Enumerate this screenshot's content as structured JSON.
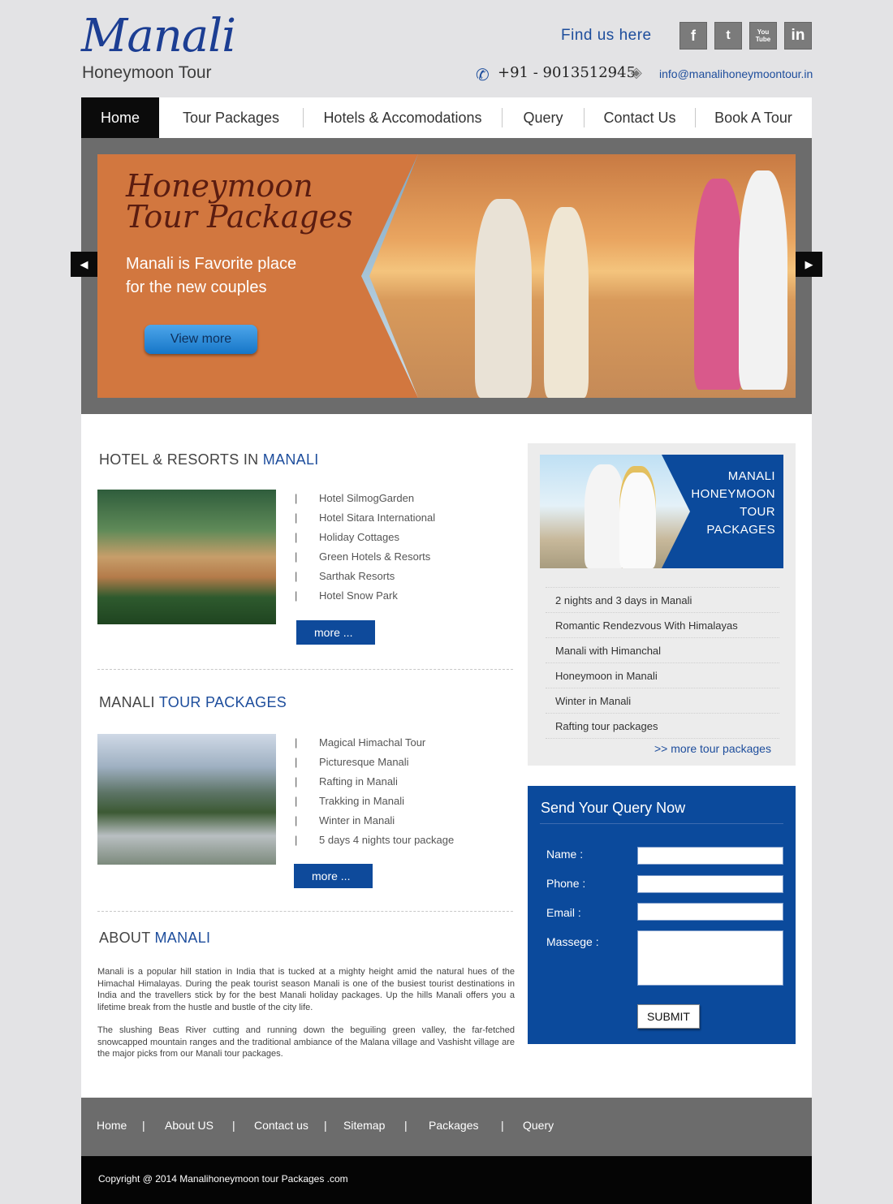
{
  "header": {
    "logo_script": "Manali",
    "logo_subtitle": "Honeymoon Tour",
    "find_us": "Find us here",
    "social": [
      {
        "icon": "facebook-icon",
        "glyph": "f"
      },
      {
        "icon": "twitter-icon",
        "glyph": "t"
      },
      {
        "icon": "youtube-icon",
        "glyph": "You Tube"
      },
      {
        "icon": "linkedin-icon",
        "glyph": "in"
      }
    ],
    "phone": "+91 - 9013512945",
    "email": "info@manalihoneymoontour.in"
  },
  "nav": {
    "items": [
      "Home",
      "Tour Packages",
      "Hotels & Accomodations",
      "Query",
      "Contact Us",
      "Book A Tour"
    ],
    "active": "Home"
  },
  "banner": {
    "title": "Honeymoon Tour Packages",
    "subtitle_line1": "Manali is Favorite place",
    "subtitle_line2": "for the new couples",
    "button": "View more",
    "prev": "◀",
    "next": "▶"
  },
  "hotels": {
    "title_plain": "HOTEL & RESORTS IN",
    "title_highlight": "MANALI",
    "items": [
      "Hotel SilmogGarden",
      "Hotel Sitara International",
      "Holiday Cottages",
      "Green Hotels & Resorts",
      "Sarthak Resorts",
      "Hotel Snow Park"
    ],
    "more": "more ..."
  },
  "tours": {
    "title_plain": "MANALI",
    "title_highlight": "TOUR PACKAGES",
    "items": [
      "Magical Himachal Tour",
      "Picturesque Manali",
      "Rafting in Manali",
      "Trakking in Manali",
      "Winter in Manali",
      "5 days 4 nights tour package"
    ],
    "more": "more ..."
  },
  "about": {
    "title_plain": "ABOUT",
    "title_highlight": "MANALI",
    "para1": "Manali is a popular hill station in India that is tucked at a mighty height amid the natural hues of the Himachal Himalayas. During the peak tourist season Manali is one of the busiest tourist destinations in India and the travellers stick by for the best Manali holiday packages. Up the hills Manali offers you a lifetime break from the hustle and bustle of the city life.",
    "para2": "The slushing Beas River cutting and running down the beguiling green valley, the far-fetched snowcapped mountain ranges and the traditional ambiance of the Malana village and Vashisht village are the major picks from our Manali tour packages."
  },
  "packages": {
    "heading_line1": "MANALI",
    "heading_line2": "HONEYMOON",
    "heading_line3": "TOUR",
    "heading_line4": "PACKAGES",
    "items": [
      "2 nights and 3 days in Manali",
      "Romantic Rendezvous With Himalayas",
      "Manali with Himanchal",
      "Honeymoon in Manali",
      "Winter in Manali",
      "Rafting tour packages"
    ],
    "more": ">> more tour packages"
  },
  "query": {
    "title": "Send Your Query Now",
    "name_label": "Name :",
    "phone_label": "Phone :",
    "email_label": "Email :",
    "message_label": "Massege :",
    "submit": "SUBMIT"
  },
  "footer": {
    "links": [
      "Home",
      "About US",
      "Contact us",
      "Sitemap",
      "Packages",
      "Query"
    ],
    "separator": "|",
    "copyright": "Copyright @ 2014 Manalihoneymoon tour Packages .com"
  },
  "colors": {
    "brand_blue": "#0b4a9c",
    "nav_active": "#0b0b0b",
    "banner_orange": "#d2773f",
    "footer_gray": "#6c6c6c"
  }
}
